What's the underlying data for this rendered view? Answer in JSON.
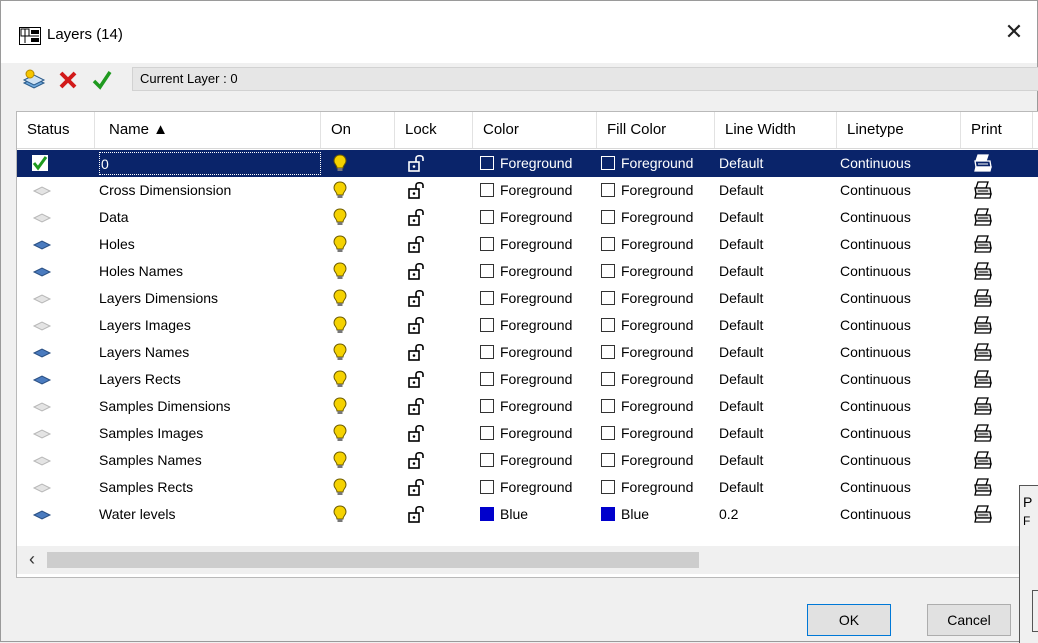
{
  "window": {
    "title": "Layers (14)",
    "close_label": "✕"
  },
  "toolbar": {
    "new_icon": "new-layer-icon",
    "delete_icon": "delete-layer-icon",
    "set_current_icon": "set-current-check-icon",
    "current_layer_text": "Current Layer : 0"
  },
  "columns": {
    "status": "Status",
    "name": "Name ▲",
    "on": "On",
    "lock": "Lock",
    "color": "Color",
    "fill_color": "Fill Color",
    "line_width": "Line Width",
    "linetype": "Linetype",
    "print": "Print"
  },
  "rows": [
    {
      "status": "current",
      "name": "0",
      "color": "Foreground",
      "fill": "Foreground",
      "width": "Default",
      "linetype": "Continuous"
    },
    {
      "status": "empty",
      "name": "Cross Dimensionsion",
      "color": "Foreground",
      "fill": "Foreground",
      "width": "Default",
      "linetype": "Continuous"
    },
    {
      "status": "empty",
      "name": "Data",
      "color": "Foreground",
      "fill": "Foreground",
      "width": "Default",
      "linetype": "Continuous"
    },
    {
      "status": "used",
      "name": "Holes",
      "color": "Foreground",
      "fill": "Foreground",
      "width": "Default",
      "linetype": "Continuous"
    },
    {
      "status": "used",
      "name": "Holes Names",
      "color": "Foreground",
      "fill": "Foreground",
      "width": "Default",
      "linetype": "Continuous"
    },
    {
      "status": "empty",
      "name": "Layers Dimensions",
      "color": "Foreground",
      "fill": "Foreground",
      "width": "Default",
      "linetype": "Continuous"
    },
    {
      "status": "empty",
      "name": "Layers Images",
      "color": "Foreground",
      "fill": "Foreground",
      "width": "Default",
      "linetype": "Continuous"
    },
    {
      "status": "used",
      "name": "Layers Names",
      "color": "Foreground",
      "fill": "Foreground",
      "width": "Default",
      "linetype": "Continuous"
    },
    {
      "status": "used",
      "name": "Layers Rects",
      "color": "Foreground",
      "fill": "Foreground",
      "width": "Default",
      "linetype": "Continuous"
    },
    {
      "status": "empty",
      "name": "Samples Dimensions",
      "color": "Foreground",
      "fill": "Foreground",
      "width": "Default",
      "linetype": "Continuous"
    },
    {
      "status": "empty",
      "name": "Samples Images",
      "color": "Foreground",
      "fill": "Foreground",
      "width": "Default",
      "linetype": "Continuous"
    },
    {
      "status": "empty",
      "name": "Samples Names",
      "color": "Foreground",
      "fill": "Foreground",
      "width": "Default",
      "linetype": "Continuous"
    },
    {
      "status": "empty",
      "name": "Samples Rects",
      "color": "Foreground",
      "fill": "Foreground",
      "width": "Default",
      "linetype": "Continuous"
    },
    {
      "status": "used",
      "name": "Water levels",
      "color": "Blue",
      "fill": "Blue",
      "width": "0.2",
      "linetype": "Continuous"
    }
  ],
  "icons": {
    "on": "lightbulb-icon",
    "lock": "unlocked-padlock-icon",
    "print": "printer-icon",
    "scroll_left": "‹"
  },
  "buttons": {
    "ok": "OK",
    "cancel": "Cancel"
  },
  "background_window": {
    "letter": "P",
    "sub": "F"
  },
  "colors": {
    "selection": "#0a246a",
    "blue_swatch": "#0000cc",
    "bulb": "#f5d200"
  }
}
